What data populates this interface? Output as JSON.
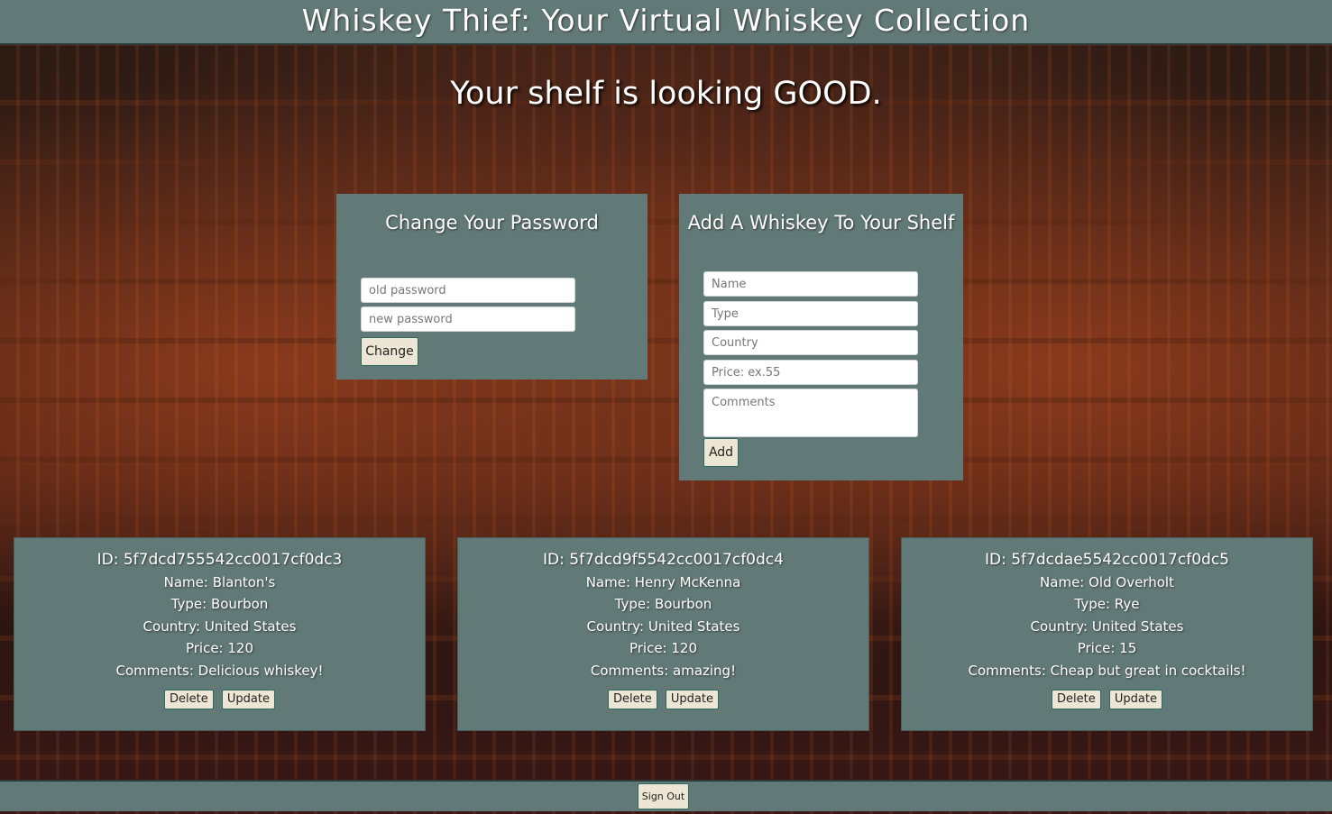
{
  "header": {
    "title": "Whiskey Thief: Your Virtual Whiskey Collection"
  },
  "tagline": "Your shelf is looking GOOD.",
  "change_password": {
    "title": "Change Your Password",
    "old_placeholder": "old password",
    "new_placeholder": "new password",
    "button_label": "Change"
  },
  "add_whiskey": {
    "title": "Add A Whiskey To Your Shelf",
    "name_placeholder": "Name",
    "type_placeholder": "Type",
    "country_placeholder": "Country",
    "price_placeholder": "Price: ex.55",
    "comments_placeholder": "Comments",
    "button_label": "Add"
  },
  "whiskeys": [
    {
      "id": "ID: 5f7dcd755542cc0017cf0dc3",
      "name": "Name: Blanton's",
      "type": "Type: Bourbon",
      "country": "Country: United States",
      "price": "Price: 120",
      "comments": "Comments: Delicious whiskey!",
      "delete_label": "Delete",
      "update_label": "Update"
    },
    {
      "id": "ID: 5f7dcd9f5542cc0017cf0dc4",
      "name": "Name: Henry McKenna",
      "type": "Type: Bourbon",
      "country": "Country: United States",
      "price": "Price: 120",
      "comments": "Comments: amazing!",
      "delete_label": "Delete",
      "update_label": "Update"
    },
    {
      "id": "ID: 5f7dcdae5542cc0017cf0dc5",
      "name": "Name: Old Overholt",
      "type": "Type: Rye",
      "country": "Country: United States",
      "price": "Price: 15",
      "comments": "Comments: Cheap but great in cocktails!",
      "delete_label": "Delete",
      "update_label": "Update"
    }
  ],
  "footer": {
    "signout_label": "Sign Out"
  },
  "colors": {
    "panel": "#617a77",
    "button": "#ede6d4",
    "button_border": "#2e6b62"
  }
}
